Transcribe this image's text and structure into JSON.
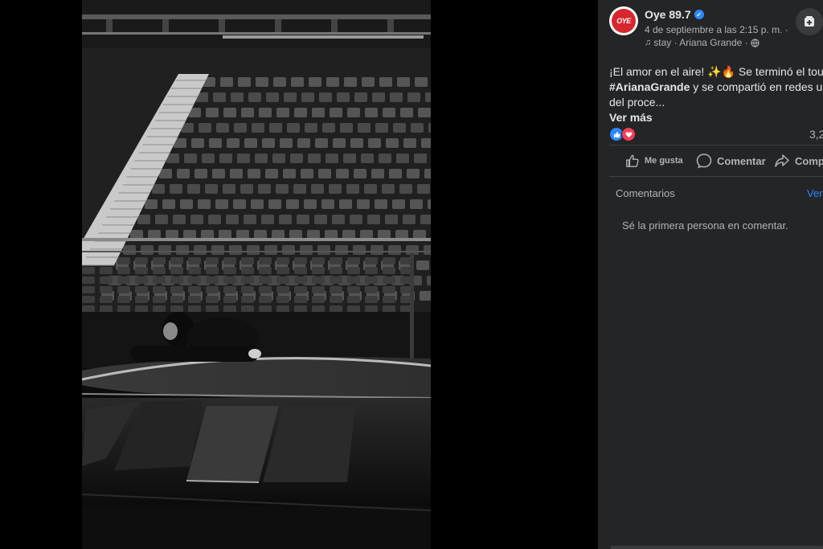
{
  "post": {
    "page_name": "Oye 89.7",
    "avatar_text": "OYE",
    "date": "4 de septiembre a las 2:15 p. m. ·",
    "audio": "stay · Ariana Grande ·",
    "text_line1": "¡El amor en el aire! ✨🔥 Se terminó el tour",
    "hashtag": "#ArianaGrande",
    "text_line2_rest": " y se compartió en redes un",
    "text_line3": "del proce...",
    "see_more": "Ver más",
    "reaction_count": "3,2"
  },
  "actions": {
    "like": "Me gusta",
    "comment": "Comentar",
    "share": "Comp"
  },
  "comments": {
    "header": "Comentarios",
    "view": "Ver",
    "empty": "Sé la primera persona en comentar."
  },
  "colors": {
    "panel_bg": "#242526",
    "accent_blue": "#2d88ff",
    "love_red": "#f33e58",
    "brand_red": "#d7262d"
  },
  "icons": [
    "verified-badge-icon",
    "globe-icon",
    "music-note-icon",
    "save-icon",
    "like-icon",
    "love-icon",
    "thumbs-up-icon",
    "comment-icon",
    "share-icon"
  ]
}
